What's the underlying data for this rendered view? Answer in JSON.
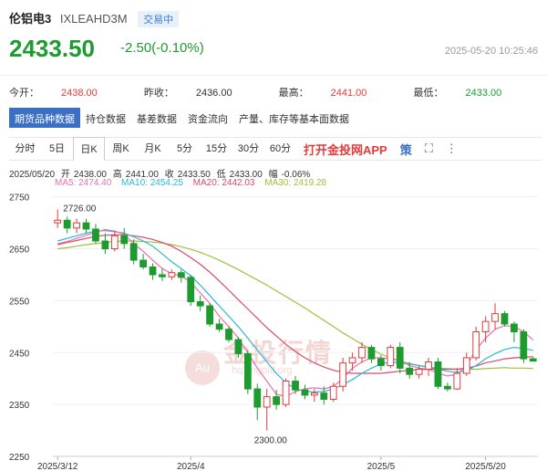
{
  "header": {
    "name": "伦铝电3",
    "code": "IXLEAHD3M",
    "status": "交易中"
  },
  "quote": {
    "price": "2433.50",
    "change": "-2.50(-0.10%)",
    "time": "2025-05-20 10:25:46"
  },
  "stats": {
    "open_label": "今开：",
    "open": "2438.00",
    "prev_label": "昨收：",
    "prev": "2436.00",
    "high_label": "最高：",
    "high": "2441.00",
    "low_label": "最低：",
    "low": "2433.00"
  },
  "tabs": [
    "期货品种数据",
    "持仓数据",
    "基差数据",
    "资金流向",
    "产量、库存等基本面数据"
  ],
  "periods": [
    "分时",
    "5日",
    "日K",
    "周K",
    "月K",
    "5分",
    "15分",
    "30分",
    "60分"
  ],
  "app_link": "打开金投网APP",
  "ce_label": "策",
  "colors": {
    "up": "#e23b3b",
    "down": "#1d9b2f",
    "ma5": "#f06ea9",
    "ma10": "#29b8d8",
    "ma20": "#d94a6b",
    "ma30": "#9bc23c"
  },
  "ohlc": {
    "date": "2025/05/20",
    "open_label": "开",
    "open": "2438.00",
    "high_label": "高",
    "high": "2441.00",
    "close_label": "收",
    "close": "2433.50",
    "low_label": "低",
    "low": "2433.00",
    "amp_label": "幅",
    "amp": "-0.06%"
  },
  "ma_legend": {
    "ma5": "MA5: 2474.40",
    "ma10": "MA10: 2454.25",
    "ma20": "MA20: 2442.03",
    "ma30": "MA30: 2419.28"
  },
  "watermark": {
    "text": "金投行情",
    "sub": "hq.cngold.org",
    "logo": "Au"
  },
  "chart_data": {
    "type": "candlestick",
    "title": "",
    "y_ticks": [
      2750,
      2650,
      2550,
      2450,
      2350,
      2250
    ],
    "ylim": [
      2250,
      2760
    ],
    "x_ticks": [
      {
        "label": "2025/3/12",
        "i": 0
      },
      {
        "label": "2025/4",
        "i": 14
      },
      {
        "label": "2025/5",
        "i": 34
      },
      {
        "label": "2025/5/20",
        "i": 45
      }
    ],
    "annotations": {
      "max": "2726.00",
      "min": "2300.00"
    },
    "candles": [
      {
        "o": 2700,
        "h": 2726,
        "l": 2690,
        "c": 2705
      },
      {
        "o": 2705,
        "h": 2712,
        "l": 2680,
        "c": 2690
      },
      {
        "o": 2690,
        "h": 2708,
        "l": 2680,
        "c": 2700
      },
      {
        "o": 2700,
        "h": 2708,
        "l": 2680,
        "c": 2688
      },
      {
        "o": 2688,
        "h": 2698,
        "l": 2660,
        "c": 2665
      },
      {
        "o": 2665,
        "h": 2680,
        "l": 2640,
        "c": 2650
      },
      {
        "o": 2650,
        "h": 2685,
        "l": 2645,
        "c": 2675
      },
      {
        "o": 2675,
        "h": 2690,
        "l": 2650,
        "c": 2660
      },
      {
        "o": 2660,
        "h": 2668,
        "l": 2620,
        "c": 2628
      },
      {
        "o": 2628,
        "h": 2640,
        "l": 2610,
        "c": 2615
      },
      {
        "o": 2615,
        "h": 2622,
        "l": 2590,
        "c": 2600
      },
      {
        "o": 2600,
        "h": 2612,
        "l": 2588,
        "c": 2596
      },
      {
        "o": 2596,
        "h": 2610,
        "l": 2590,
        "c": 2604
      },
      {
        "o": 2604,
        "h": 2610,
        "l": 2585,
        "c": 2595
      },
      {
        "o": 2595,
        "h": 2600,
        "l": 2540,
        "c": 2548
      },
      {
        "o": 2548,
        "h": 2560,
        "l": 2530,
        "c": 2540
      },
      {
        "o": 2540,
        "h": 2545,
        "l": 2500,
        "c": 2505
      },
      {
        "o": 2505,
        "h": 2515,
        "l": 2490,
        "c": 2495
      },
      {
        "o": 2495,
        "h": 2500,
        "l": 2470,
        "c": 2475
      },
      {
        "o": 2475,
        "h": 2480,
        "l": 2440,
        "c": 2448
      },
      {
        "o": 2448,
        "h": 2455,
        "l": 2370,
        "c": 2380
      },
      {
        "o": 2380,
        "h": 2390,
        "l": 2320,
        "c": 2345
      },
      {
        "o": 2345,
        "h": 2380,
        "l": 2300,
        "c": 2365
      },
      {
        "o": 2365,
        "h": 2378,
        "l": 2340,
        "c": 2350
      },
      {
        "o": 2350,
        "h": 2400,
        "l": 2345,
        "c": 2395
      },
      {
        "o": 2395,
        "h": 2405,
        "l": 2370,
        "c": 2378
      },
      {
        "o": 2378,
        "h": 2388,
        "l": 2360,
        "c": 2368
      },
      {
        "o": 2368,
        "h": 2380,
        "l": 2355,
        "c": 2372
      },
      {
        "o": 2372,
        "h": 2385,
        "l": 2350,
        "c": 2360
      },
      {
        "o": 2360,
        "h": 2392,
        "l": 2355,
        "c": 2385
      },
      {
        "o": 2385,
        "h": 2440,
        "l": 2375,
        "c": 2430
      },
      {
        "o": 2430,
        "h": 2450,
        "l": 2415,
        "c": 2440
      },
      {
        "o": 2440,
        "h": 2470,
        "l": 2430,
        "c": 2460
      },
      {
        "o": 2460,
        "h": 2465,
        "l": 2430,
        "c": 2438
      },
      {
        "o": 2438,
        "h": 2445,
        "l": 2415,
        "c": 2425
      },
      {
        "o": 2425,
        "h": 2465,
        "l": 2420,
        "c": 2460
      },
      {
        "o": 2460,
        "h": 2470,
        "l": 2410,
        "c": 2420
      },
      {
        "o": 2420,
        "h": 2432,
        "l": 2400,
        "c": 2408
      },
      {
        "o": 2408,
        "h": 2425,
        "l": 2400,
        "c": 2418
      },
      {
        "o": 2418,
        "h": 2440,
        "l": 2405,
        "c": 2432
      },
      {
        "o": 2432,
        "h": 2440,
        "l": 2380,
        "c": 2385
      },
      {
        "o": 2385,
        "h": 2392,
        "l": 2375,
        "c": 2380
      },
      {
        "o": 2380,
        "h": 2420,
        "l": 2378,
        "c": 2410
      },
      {
        "o": 2410,
        "h": 2450,
        "l": 2405,
        "c": 2440
      },
      {
        "o": 2440,
        "h": 2500,
        "l": 2435,
        "c": 2490
      },
      {
        "o": 2490,
        "h": 2520,
        "l": 2470,
        "c": 2510
      },
      {
        "o": 2510,
        "h": 2545,
        "l": 2495,
        "c": 2525
      },
      {
        "o": 2525,
        "h": 2530,
        "l": 2500,
        "c": 2505
      },
      {
        "o": 2505,
        "h": 2510,
        "l": 2470,
        "c": 2490
      },
      {
        "o": 2490,
        "h": 2495,
        "l": 2430,
        "c": 2438
      },
      {
        "o": 2438,
        "h": 2441,
        "l": 2433,
        "c": 2433.5
      }
    ],
    "ma5": [
      2660,
      2664,
      2670,
      2676,
      2682,
      2687,
      2684,
      2678,
      2660,
      2645,
      2628,
      2612,
      2602,
      2598,
      2585,
      2565,
      2545,
      2520,
      2500,
      2478,
      2450,
      2420,
      2395,
      2370,
      2365,
      2375,
      2380,
      2382,
      2380,
      2385,
      2400,
      2420,
      2432,
      2440,
      2440,
      2438,
      2435,
      2425,
      2420,
      2418,
      2410,
      2405,
      2408,
      2425,
      2455,
      2478,
      2495,
      2502,
      2500,
      2490,
      2474.4
    ],
    "ma10": [
      2665,
      2670,
      2675,
      2680,
      2684,
      2685,
      2683,
      2680,
      2673,
      2665,
      2655,
      2640,
      2625,
      2612,
      2598,
      2580,
      2560,
      2540,
      2520,
      2500,
      2478,
      2455,
      2432,
      2410,
      2392,
      2380,
      2376,
      2374,
      2375,
      2380,
      2388,
      2398,
      2410,
      2420,
      2428,
      2432,
      2430,
      2428,
      2425,
      2422,
      2418,
      2414,
      2412,
      2415,
      2425,
      2438,
      2448,
      2456,
      2460,
      2458,
      2454.25
    ],
    "ma20": [
      2658,
      2662,
      2666,
      2670,
      2674,
      2676,
      2677,
      2677,
      2675,
      2672,
      2668,
      2662,
      2655,
      2645,
      2633,
      2620,
      2605,
      2588,
      2570,
      2552,
      2534,
      2516,
      2498,
      2482,
      2466,
      2452,
      2440,
      2430,
      2422,
      2416,
      2412,
      2410,
      2410,
      2410,
      2410,
      2412,
      2414,
      2416,
      2417,
      2418,
      2418,
      2418,
      2418,
      2420,
      2424,
      2430,
      2434,
      2438,
      2440,
      2441,
      2442.03
    ],
    "ma30": [
      2650,
      2652,
      2655,
      2658,
      2660,
      2662,
      2664,
      2665,
      2665,
      2664,
      2663,
      2661,
      2658,
      2654,
      2649,
      2643,
      2636,
      2628,
      2619,
      2610,
      2600,
      2590,
      2580,
      2569,
      2558,
      2547,
      2536,
      2524,
      2512,
      2500,
      2488,
      2477,
      2466,
      2456,
      2447,
      2440,
      2434,
      2429,
      2425,
      2422,
      2420,
      2419,
      2418,
      2418,
      2418,
      2419,
      2420,
      2421,
      2420,
      2420,
      2419.28
    ]
  }
}
